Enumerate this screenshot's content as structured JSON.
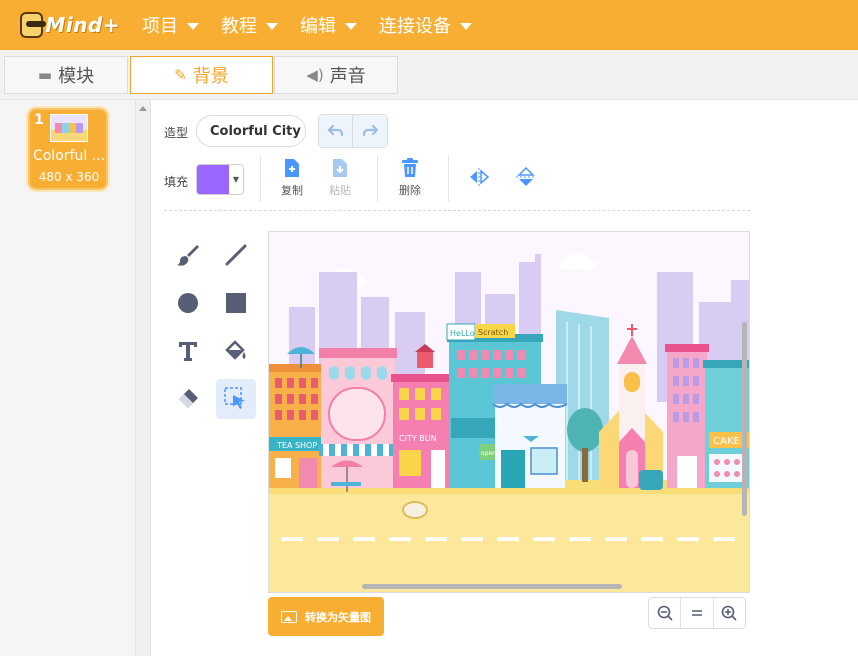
{
  "app": {
    "logo_text": "Mind+"
  },
  "menu": [
    {
      "label": "项目"
    },
    {
      "label": "教程"
    },
    {
      "label": "编辑"
    },
    {
      "label": "连接设备"
    }
  ],
  "tabs": [
    {
      "label": "模块",
      "icon": "blocks-icon"
    },
    {
      "label": "背景",
      "icon": "brush-icon",
      "active": true
    },
    {
      "label": "声音",
      "icon": "speaker-icon"
    }
  ],
  "costumes": [
    {
      "index": "1",
      "name": "Colorful ...",
      "size": "480 x 360"
    }
  ],
  "editor": {
    "costume_label": "造型",
    "costume_name": "Colorful City",
    "fill_label": "填充",
    "fill_color": "#9966ff",
    "actions": {
      "copy": "复制",
      "paste": "粘贴",
      "delete": "删除"
    },
    "convert_label": "转换为矢量图"
  },
  "canvas_text": {
    "hello": "HeLLo",
    "scratch": "Scratch",
    "tea_shop": "TEA SHOP",
    "city_bun": "CITY BUN",
    "cake": "CAKE",
    "open": "open"
  },
  "colors": {
    "accent": "#f8ae32",
    "active_tab": "#f0a428",
    "tool_blue": "#4c97ff"
  }
}
